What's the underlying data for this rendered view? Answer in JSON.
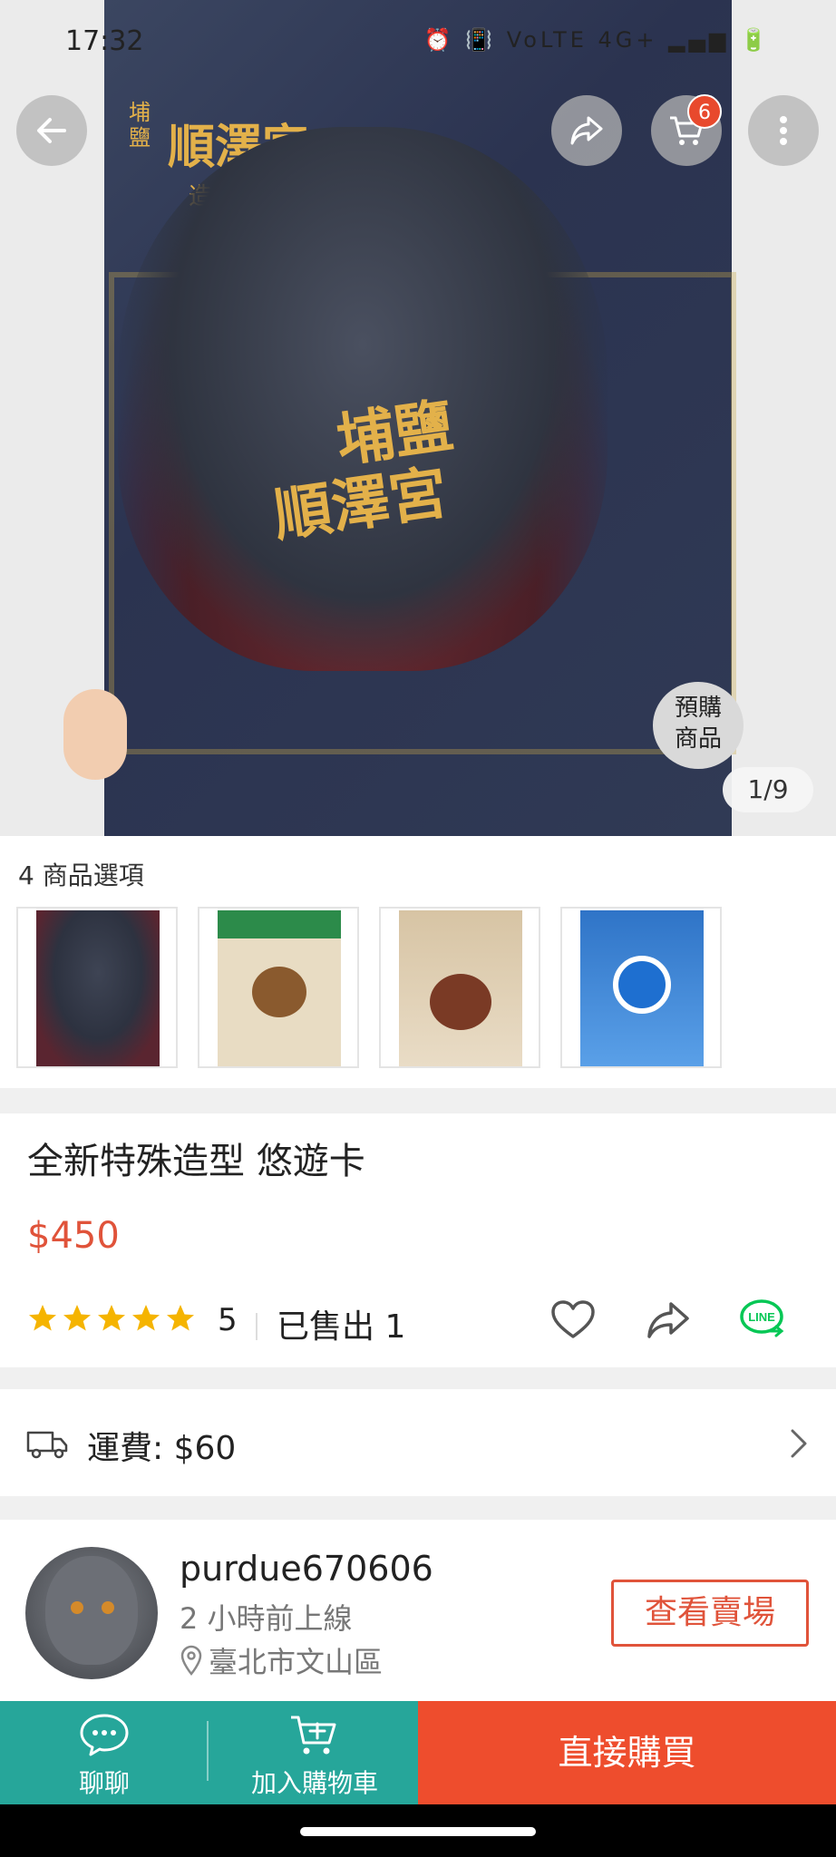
{
  "status_bar": {
    "time": "17:32",
    "indicators": "⏰ 📳 VoLTE 4G+ ▂▄▆ 🔋"
  },
  "hero": {
    "image_counter": "1/9",
    "cart_badge_count": "6",
    "photo_text_top": "順澤宮",
    "photo_text_side": "埔鹽",
    "photo_text_sub": "造型",
    "photo_text_hat_1": "埔鹽",
    "photo_text_hat_2": "順澤宮",
    "preorder_stamp_1": "預購",
    "preorder_stamp_2": "商品"
  },
  "options": {
    "label": "4 商品選項"
  },
  "product": {
    "title": "全新特殊造型 悠遊卡",
    "price": "$450",
    "rating": "5",
    "sold": "已售出 1"
  },
  "shipping": {
    "label": "運費: $60"
  },
  "seller": {
    "name": "purdue670606",
    "last_online": "2 小時前上線",
    "location": "臺北市文山區",
    "view_shop": "查看賣場"
  },
  "bottom_bar": {
    "chat": "聊聊",
    "add_to_cart": "加入購物車",
    "buy_now": "直接購買"
  },
  "colors": {
    "accent": "#e0533a",
    "teal": "#26a69a",
    "buy": "#ee4d2d",
    "line_green": "#06c755",
    "star": "#f5b400"
  }
}
